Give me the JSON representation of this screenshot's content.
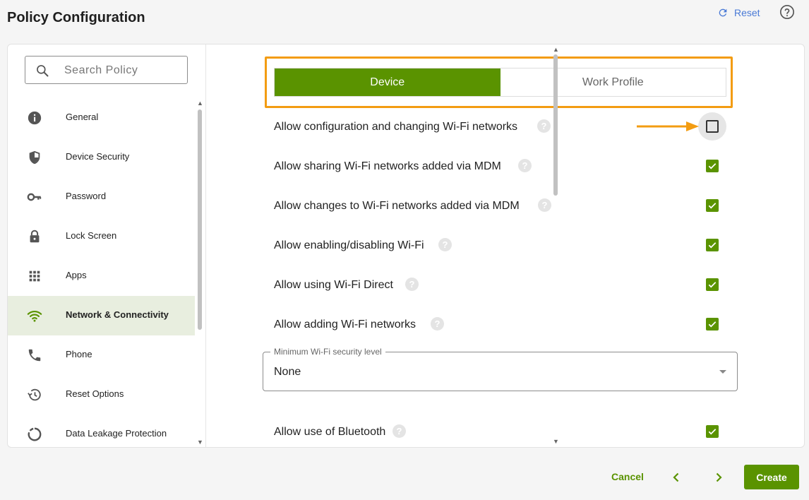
{
  "header": {
    "title": "Policy Configuration",
    "reset_label": "Reset",
    "help_icon": "help-circle-icon"
  },
  "search": {
    "placeholder": "Search Policy",
    "icon": "search-icon"
  },
  "sidebar": {
    "items": [
      {
        "label": "General",
        "icon": "info-icon",
        "active": false
      },
      {
        "label": "Device Security",
        "icon": "shield-icon",
        "active": false
      },
      {
        "label": "Password",
        "icon": "key-icon",
        "active": false
      },
      {
        "label": "Lock Screen",
        "icon": "lock-icon",
        "active": false
      },
      {
        "label": "Apps",
        "icon": "apps-grid-icon",
        "active": false
      },
      {
        "label": "Network & Connectivity",
        "icon": "wifi-icon",
        "active": true
      },
      {
        "label": "Phone",
        "icon": "phone-icon",
        "active": false
      },
      {
        "label": "Reset Options",
        "icon": "history-icon",
        "active": false
      },
      {
        "label": "Data Leakage Protection",
        "icon": "loading-ring-icon",
        "active": false
      }
    ]
  },
  "tabs": [
    {
      "label": "Device",
      "active": true
    },
    {
      "label": "Work Profile",
      "active": false
    }
  ],
  "settings": [
    {
      "label": "Allow configuration and changing Wi-Fi networks",
      "checked": false
    },
    {
      "label": "Allow sharing Wi-Fi networks added via MDM",
      "checked": true
    },
    {
      "label": "Allow changes to Wi-Fi networks added via MDM",
      "checked": true
    },
    {
      "label": "Allow enabling/disabling Wi-Fi",
      "checked": true
    },
    {
      "label": "Allow using Wi-Fi Direct",
      "checked": true
    },
    {
      "label": "Allow adding Wi-Fi networks",
      "checked": true
    }
  ],
  "security_select": {
    "legend": "Minimum Wi-Fi security level",
    "value": "None"
  },
  "bluetooth": {
    "label": "Allow use of Bluetooth",
    "checked": true
  },
  "help_mark": "?",
  "footer": {
    "cancel_label": "Cancel",
    "create_label": "Create"
  },
  "colors": {
    "accent": "#5a9300",
    "highlight": "#f39c12",
    "link": "#4a7ad6"
  }
}
